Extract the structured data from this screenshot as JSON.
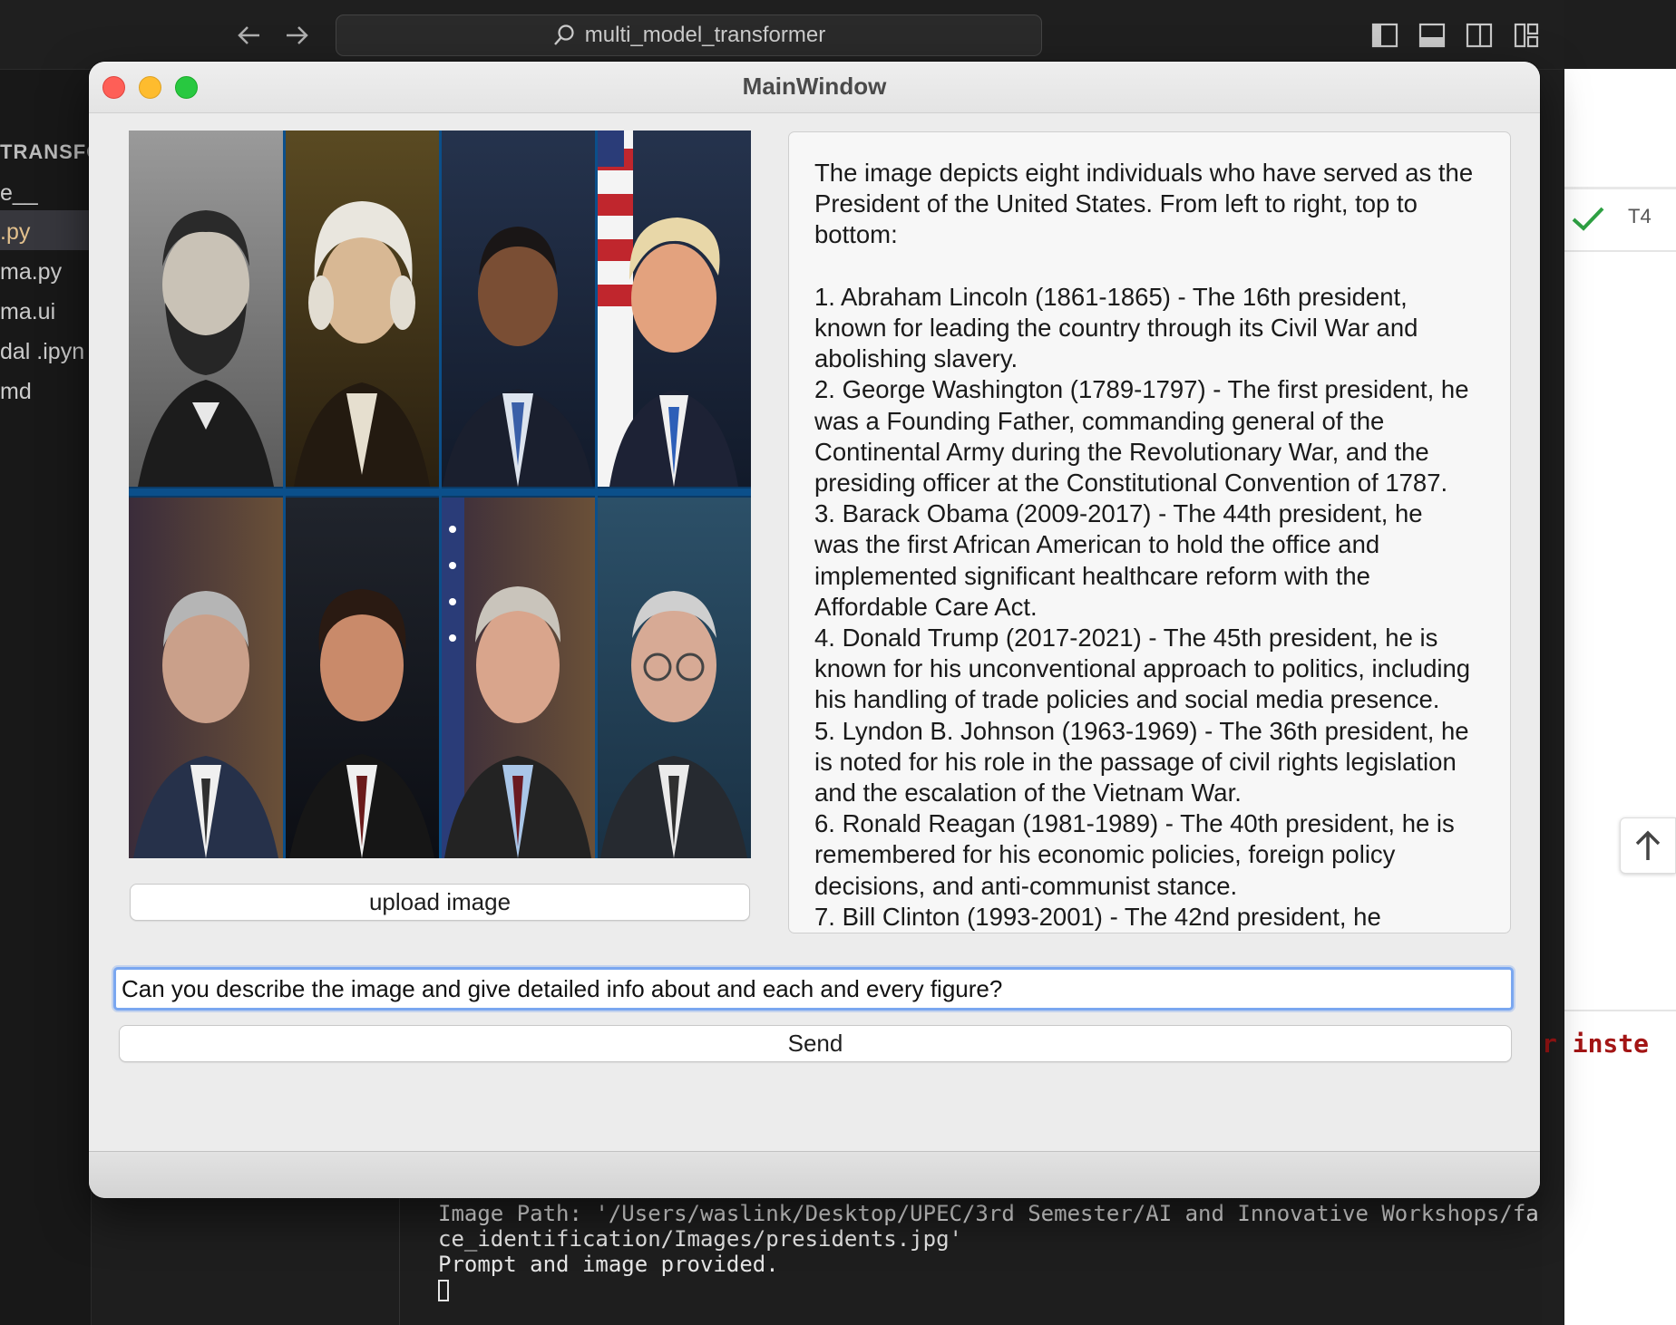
{
  "vscode": {
    "search_text": "multi_model_transformer",
    "explorer": {
      "header": "TRANSFO",
      "items": [
        "e__",
        ".py",
        "ma.py",
        "ma.ui",
        "dal .ipyn",
        "md"
      ]
    },
    "right_panel": {
      "tab_label": "T4",
      "code_snippet": "r inste"
    },
    "terminal": {
      "lines": [
        "Image Path: '/Users/waslink/Desktop/UPEC/3rd Semester/AI and Innovative Workshops/fa",
        "ce_identification/Images/presidents.jpg'",
        "Prompt and image provided."
      ]
    }
  },
  "window": {
    "title": "MainWindow",
    "upload_label": "upload image",
    "response_text": "The image depicts eight individuals who have served as the\nPresident of the United States. From left to right, top to\nbottom:\n\n1. Abraham Lincoln (1861-1865) - The 16th president,\nknown for leading the country through its Civil War and\nabolishing slavery.\n2. George Washington (1789-1797) - The first president, he\nwas a Founding Father, commanding general of the\nContinental Army during the Revolutionary War, and the\npresiding officer at the Constitutional Convention of 1787.\n3. Barack Obama (2009-2017) - The 44th president, he\nwas the first African American to hold the office and\nimplemented significant healthcare reform with the\nAffordable Care Act.\n4. Donald Trump (2017-2021) - The 45th president, he is\nknown for his unconventional approach to politics, including\nhis handling of trade policies and social media presence.\n5. Lyndon B. Johnson (1963-1969) - The 36th president, he\nis noted for his role in the passage of civil rights legislation\nand the escalation of the Vietnam War.\n6. Ronald Reagan (1981-1989) - The 40th president, he is\nremembered for his economic policies, foreign policy\ndecisions, and anti-communist stance.\n7. Bill Clinton (1993-2001) - The 42nd president, he",
    "prompt_value": "Can you describe the image and give detailed info about and each and every figure?",
    "send_label": "Send"
  },
  "colors": {
    "close": "#fe5f57",
    "minimize": "#febc2e",
    "maximize": "#28c840",
    "focus_ring": "#7aa7f0",
    "check": "#2ea043"
  },
  "icons": [
    "back-arrow-icon",
    "forward-arrow-icon",
    "search-icon",
    "toggle-sidebar-icon",
    "toggle-panel-icon",
    "toggle-secondary-sidebar-icon",
    "customize-layout-icon",
    "checkmark-icon",
    "arrow-up-icon"
  ]
}
